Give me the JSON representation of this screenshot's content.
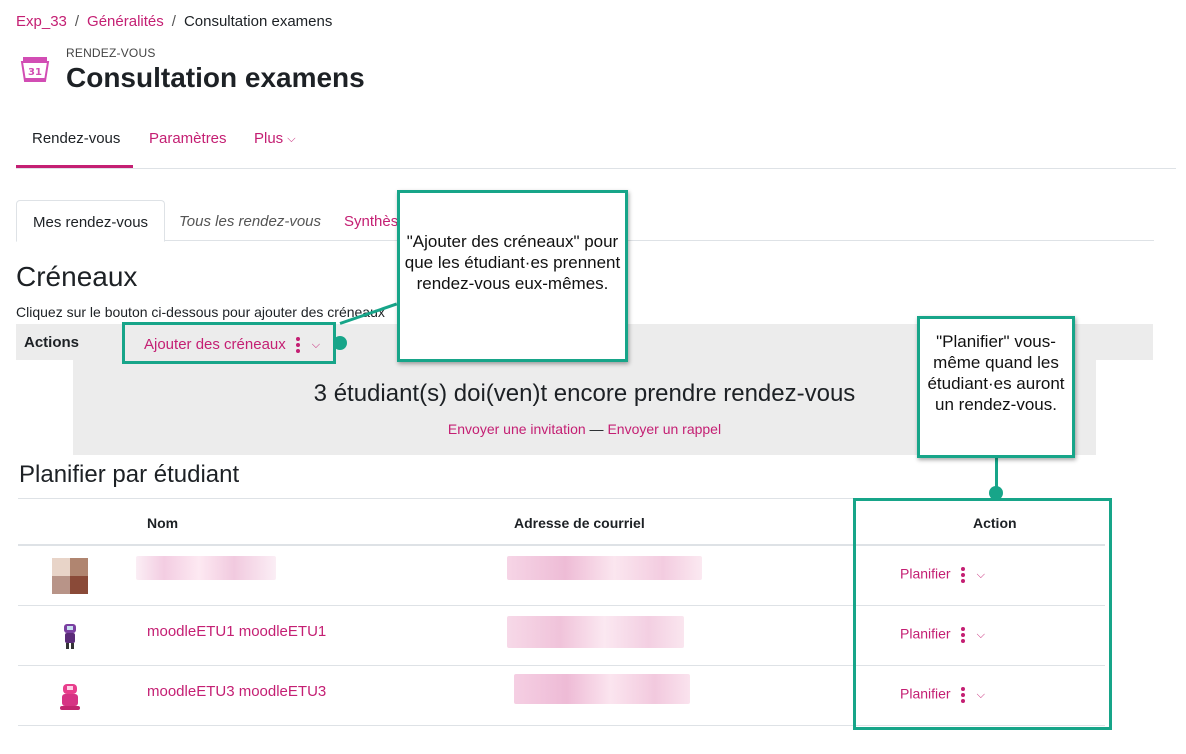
{
  "breadcrumb": {
    "items": [
      "Exp_33",
      "Généralités"
    ],
    "current": "Consultation examens"
  },
  "header": {
    "kicker": "RENDEZ-VOUS",
    "title": "Consultation examens",
    "icon_day": "31"
  },
  "primary_nav": {
    "items": [
      "Rendez-vous",
      "Paramètres",
      "Plus"
    ]
  },
  "tabs": [
    "Mes rendez-vous",
    "Tous les rendez-vous",
    "Synthèse"
  ],
  "slots": {
    "heading": "Créneaux",
    "intro": "Cliquez sur le bouton ci-dessous pour ajouter des créneaux",
    "actions_label": "Actions",
    "add_label": "Ajouter des créneaux"
  },
  "remaining": {
    "text": "3 étudiant(s) doi(ven)t encore prendre rendez-vous",
    "invite": "Envoyer une invitation",
    "dash": " — ",
    "reminder": "Envoyer un rappel"
  },
  "schedule": {
    "heading": "Planifier par étudiant",
    "columns": [
      "Nom",
      "Adresse de courriel",
      "Action"
    ],
    "rows": [
      {
        "name": "",
        "action": "Planifier"
      },
      {
        "name": "moodleETU1 moodleETU1",
        "action": "Planifier"
      },
      {
        "name": "moodleETU3 moodleETU3",
        "action": "Planifier"
      }
    ]
  },
  "callouts": {
    "first": "\"Ajouter des créneaux\" pour que les étudiant·es prennent rendez-vous eux-mêmes.",
    "second": "\"Planifier\" vous-même quand les étudiant·es auront un rendez-vous."
  },
  "colors": {
    "accent": "#c41f73",
    "callout": "#17a589",
    "panel": "#ececec"
  }
}
